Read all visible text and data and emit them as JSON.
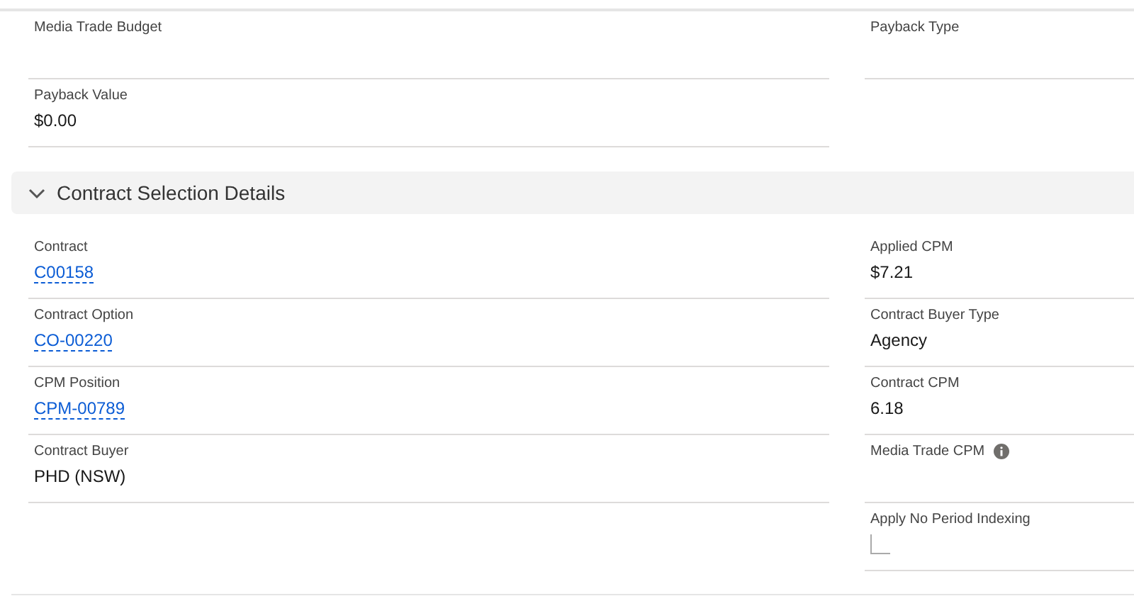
{
  "top_section": {
    "left": [
      {
        "label": "Media Trade Budget"
      },
      {
        "label": "Payback Value",
        "kind": "text",
        "value": "$0.00"
      }
    ],
    "right": [
      {
        "label": "Payback Type"
      }
    ]
  },
  "section": {
    "title": "Contract Selection Details",
    "expanded": true,
    "left": [
      {
        "label": "Contract",
        "kind": "link",
        "value": "C00158"
      },
      {
        "label": "Contract Option",
        "kind": "link",
        "value": "CO-00220"
      },
      {
        "label": "CPM Position",
        "kind": "link",
        "value": "CPM-00789"
      },
      {
        "label": "Contract Buyer",
        "kind": "text",
        "value": "PHD (NSW)"
      }
    ],
    "right": [
      {
        "label": "Applied CPM",
        "kind": "text",
        "value": "$7.21"
      },
      {
        "label": "Contract Buyer Type",
        "kind": "text",
        "value": "Agency"
      },
      {
        "label": "Contract CPM",
        "kind": "text",
        "value": "6.18"
      },
      {
        "label": "Media Trade CPM",
        "help": true
      },
      {
        "label": "Apply No Period Indexing",
        "kind": "checkbox",
        "checked": false
      }
    ]
  }
}
